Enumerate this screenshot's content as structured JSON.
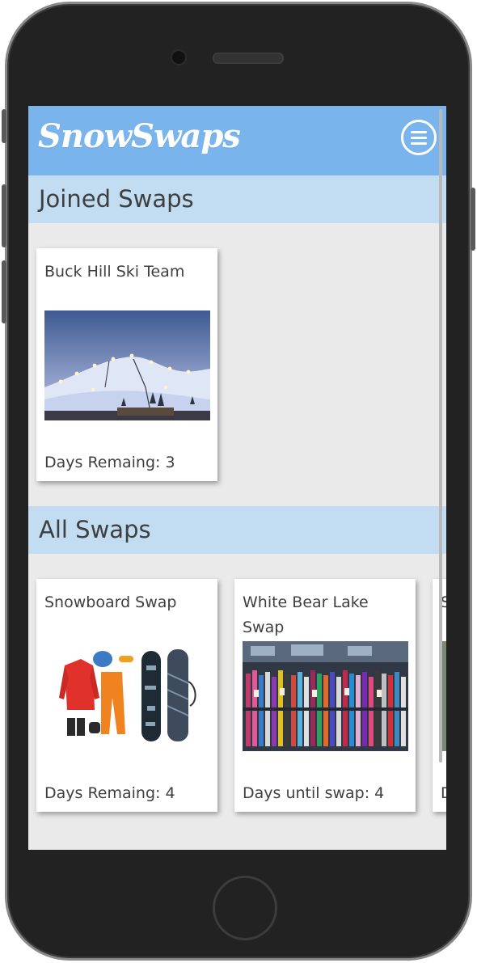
{
  "app": {
    "logo_text": "SnowSwaps",
    "menu_icon": "hamburger-menu-icon"
  },
  "joined": {
    "title": "Joined Swaps",
    "cards": [
      {
        "title": "Buck Hill Ski Team",
        "image": "ski-hill-night-image",
        "footer": "Days Remaing: 3"
      }
    ]
  },
  "all": {
    "title": "All Swaps",
    "cards": [
      {
        "title": "Snowboard Swap",
        "image": "snowboard-gear-image",
        "footer": "Days Remaing: 4"
      },
      {
        "title": "White Bear Lake Swap",
        "image": "ski-rack-image",
        "footer": "Days until swap: 4"
      },
      {
        "title": "S R",
        "image": "partial-image",
        "footer": "D"
      }
    ]
  },
  "colors": {
    "appbar": "#79b4ec",
    "section_header": "#c2dcf2",
    "screen_bg": "#eaeaea",
    "text": "#3f3f3f"
  }
}
